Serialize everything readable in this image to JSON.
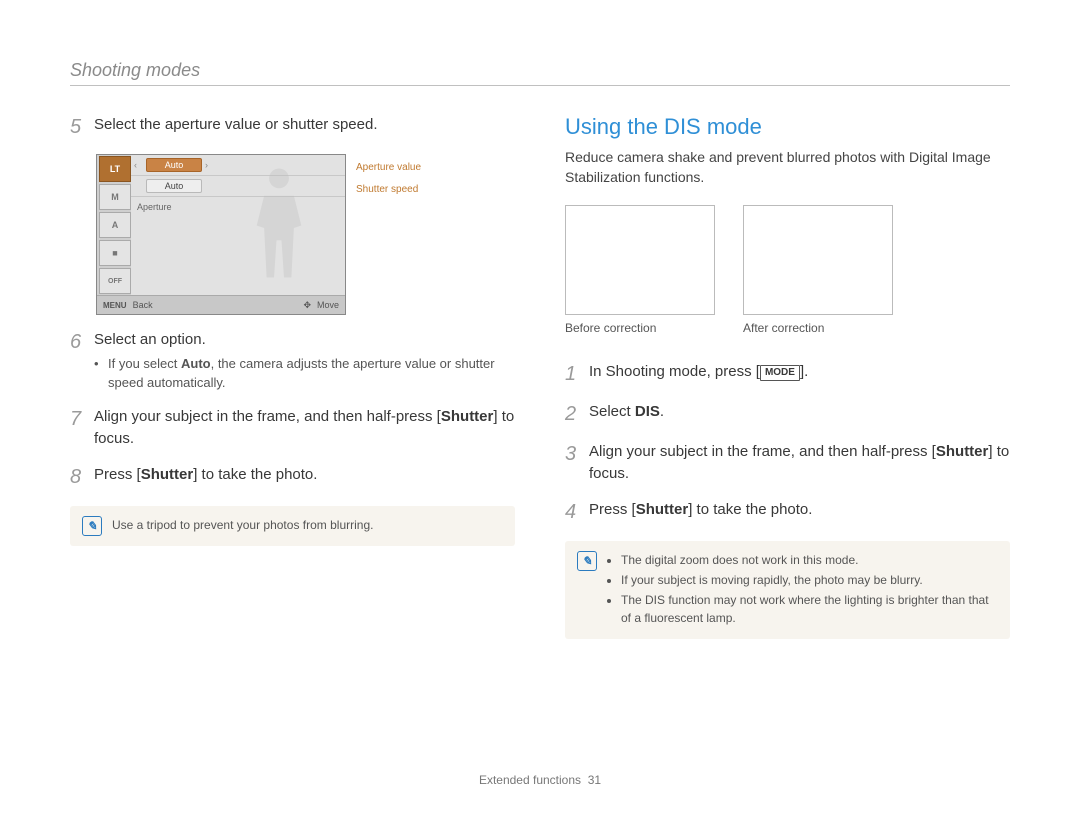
{
  "header": {
    "title": "Shooting modes"
  },
  "left": {
    "steps": {
      "s5": {
        "num": "5",
        "text": "Select the aperture value or shutter speed."
      },
      "s6": {
        "num": "6",
        "text": "Select an option.",
        "sub_prefix": "If you select ",
        "sub_bold": "Auto",
        "sub_suffix": ", the camera adjusts the aperture value or shutter speed automatically."
      },
      "s7": {
        "num": "7",
        "prefix": "Align your subject in the frame, and then half-press [",
        "bold": "Shutter",
        "suffix": "] to focus."
      },
      "s8": {
        "num": "8",
        "prefix": "Press [",
        "bold": "Shutter",
        "suffix": "] to take the photo."
      }
    },
    "screen": {
      "side": [
        "LT",
        "M",
        "A",
        "■",
        "OFF"
      ],
      "row1": {
        "left_arrow": "‹",
        "value": "Auto",
        "right_arrow": "›"
      },
      "row2": {
        "value": "Auto"
      },
      "row3_label": "Aperture",
      "status": {
        "menu": "MENU",
        "back": "Back",
        "move_icon": "✥",
        "move": "Move"
      },
      "annotation1": "Aperture value",
      "annotation2": "Shutter speed"
    },
    "note": "Use a tripod to prevent your photos from blurring."
  },
  "right": {
    "heading": "Using the DIS mode",
    "intro": "Reduce camera shake and prevent blurred photos with Digital Image Stabilization functions.",
    "fig1_caption": "Before correction",
    "fig2_caption": "After correction",
    "steps": {
      "s1": {
        "num": "1",
        "prefix": "In Shooting mode, press [",
        "kbd": "MODE",
        "suffix": "]."
      },
      "s2": {
        "num": "2",
        "prefix": "Select ",
        "bold": "DIS",
        "suffix": "."
      },
      "s3": {
        "num": "3",
        "prefix": "Align your subject in the frame, and then half-press [",
        "bold": "Shutter",
        "suffix": "] to focus."
      },
      "s4": {
        "num": "4",
        "prefix": "Press [",
        "bold": "Shutter",
        "suffix": "] to take the photo."
      }
    },
    "notes": [
      "The digital zoom does not work in this mode.",
      "If your subject is moving rapidly, the photo may be blurry.",
      "The DIS function may not work where the lighting is brighter than that of a fluorescent lamp."
    ]
  },
  "footer": {
    "section": "Extended functions",
    "page": "31"
  }
}
